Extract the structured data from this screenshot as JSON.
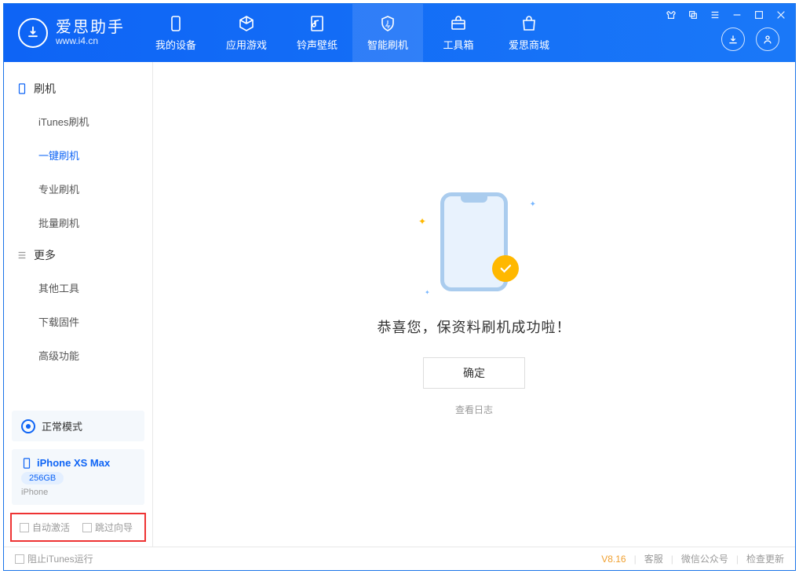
{
  "app": {
    "name": "爱思助手",
    "url": "www.i4.cn"
  },
  "nav": [
    {
      "label": "我的设备"
    },
    {
      "label": "应用游戏"
    },
    {
      "label": "铃声壁纸"
    },
    {
      "label": "智能刷机"
    },
    {
      "label": "工具箱"
    },
    {
      "label": "爱思商城"
    }
  ],
  "sidebar": {
    "group1_title": "刷机",
    "group1": [
      "iTunes刷机",
      "一键刷机",
      "专业刷机",
      "批量刷机"
    ],
    "group2_title": "更多",
    "group2": [
      "其他工具",
      "下载固件",
      "高级功能"
    ]
  },
  "mode": {
    "label": "正常模式"
  },
  "device": {
    "name": "iPhone XS Max",
    "capacity": "256GB",
    "type": "iPhone"
  },
  "checkboxes": {
    "auto_activate": "自动激活",
    "skip_guide": "跳过向导"
  },
  "main": {
    "success": "恭喜您，保资料刷机成功啦！",
    "confirm": "确定",
    "view_log": "查看日志"
  },
  "statusbar": {
    "block_itunes": "阻止iTunes运行",
    "version": "V8.16",
    "links": [
      "客服",
      "微信公众号",
      "检查更新"
    ]
  }
}
